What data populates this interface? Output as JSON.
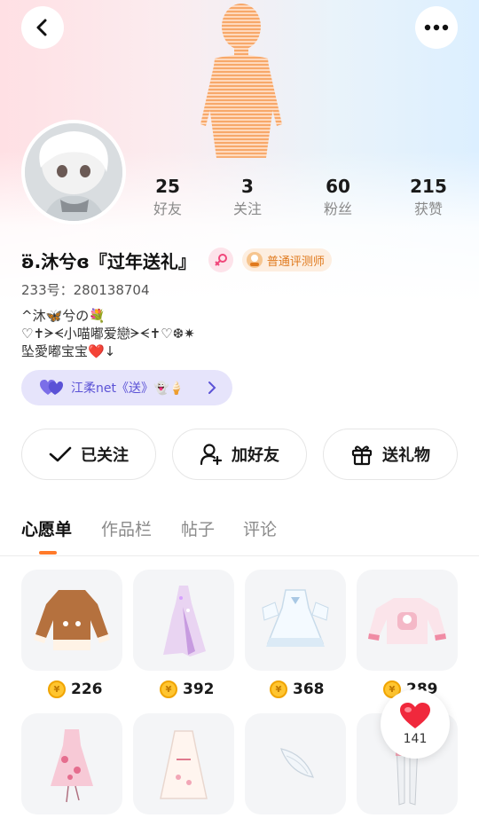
{
  "header": {
    "back_icon": "chevron-left-icon",
    "more_icon": "more-dots-icon"
  },
  "profile": {
    "stats": [
      {
        "value": "25",
        "label": "好友"
      },
      {
        "value": "3",
        "label": "关注"
      },
      {
        "value": "60",
        "label": "粉丝"
      },
      {
        "value": "215",
        "label": "获赞"
      }
    ],
    "username": "ʚ⃛⃛.沐兮ɞ『过年送礼』",
    "tester_badge": "普通评测师",
    "id_line": "233号：280138704",
    "bio": [
      "^沐🦋兮の💐",
      "♡✝︎ᗒᗕ小喵嘟爱戀ᗒᗕ✝︎♡❆✷",
      "坠愛嘟宝宝❤️↓"
    ],
    "group": "江柔net《送》👻🍦"
  },
  "actions": [
    {
      "label": "已关注",
      "icon": "check-icon"
    },
    {
      "label": "加好友",
      "icon": "add-friend-icon"
    },
    {
      "label": "送礼物",
      "icon": "gift-icon"
    }
  ],
  "tabs": [
    {
      "label": "心愿单",
      "active": true
    },
    {
      "label": "作品栏",
      "active": false
    },
    {
      "label": "帖子",
      "active": false
    },
    {
      "label": "评论",
      "active": false
    }
  ],
  "wishlist": [
    {
      "price": "226",
      "item": "brown-jacket"
    },
    {
      "price": "392",
      "item": "purple-gown"
    },
    {
      "price": "368",
      "item": "white-lolita-dress"
    },
    {
      "price": "289",
      "item": "pink-sweater"
    },
    {
      "price": "",
      "item": "pink-floral-dress"
    },
    {
      "price": "",
      "item": "white-nightgown"
    },
    {
      "price": "",
      "item": "white-wings"
    },
    {
      "price": "",
      "item": "white-stockings"
    }
  ],
  "like": {
    "count": "141"
  },
  "colors": {
    "accent": "#ff7a2a",
    "group_text": "#5b52d6",
    "group_bg": "#e6e4fb",
    "tester_text": "#e07a1e",
    "coin": "#ffc530",
    "heart": "#f0283c"
  }
}
